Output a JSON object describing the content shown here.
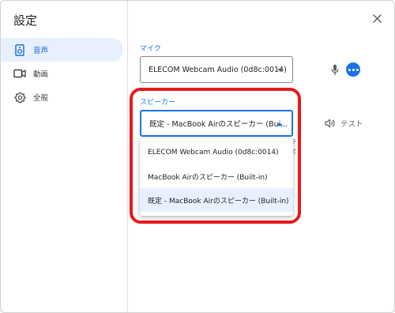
{
  "dialog": {
    "title": "設定",
    "close_icon": "close-icon"
  },
  "sidebar": {
    "items": [
      {
        "label": "音声",
        "icon": "speaker-icon",
        "active": true
      },
      {
        "label": "動画",
        "icon": "video-camera-icon",
        "active": false
      },
      {
        "label": "全般",
        "icon": "gear-icon",
        "active": false
      }
    ]
  },
  "microphone": {
    "label": "マイク",
    "selected_value": "ELECOM Webcam Audio (0d8c:0014)",
    "icon": "microphone-icon",
    "more_icon": "more-options-icon"
  },
  "speaker": {
    "label": "スピーカー",
    "selected_value": "既定 - MacBook Airのスピーカー (Bui...",
    "test_label": "テスト",
    "test_icon": "volume-icon",
    "options": [
      "ELECOM Webcam Audio (0d8c:0014)",
      "MacBook Airのスピーカー (Built-in)",
      "既定 - MacBook Airのスピーカー (Built-in)"
    ],
    "highlighted_option_index": 2
  },
  "obscured_text": {
    "line1": "テ",
    "line2": "て"
  },
  "colors": {
    "accent": "#1a73e8",
    "active_nav_bg": "#e8f0fe",
    "highlight_box": "#e8191b"
  }
}
